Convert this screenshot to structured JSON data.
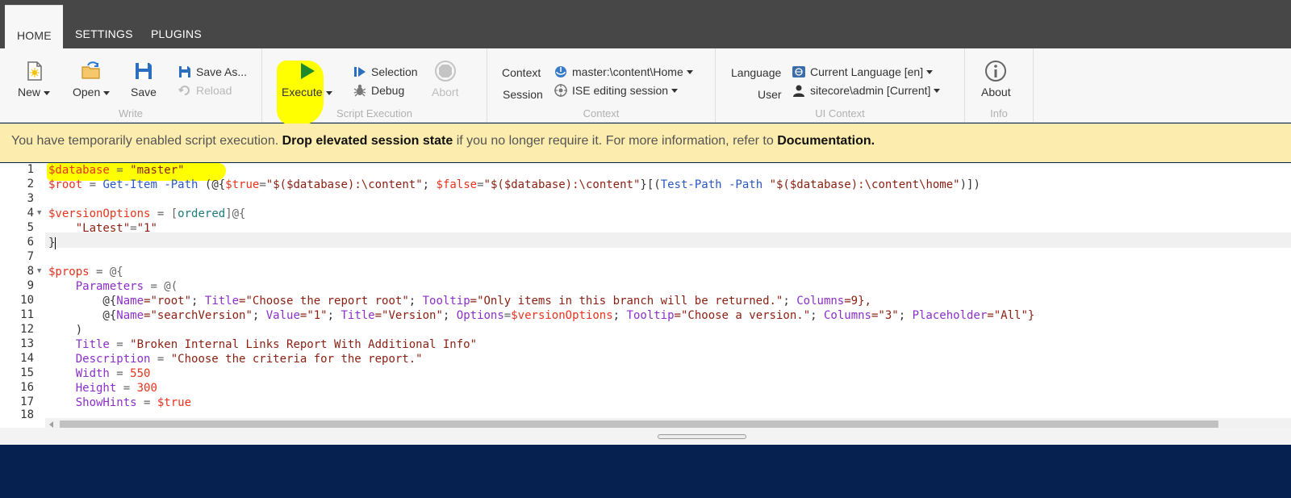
{
  "tabs": [
    {
      "label": "HOME",
      "active": true
    },
    {
      "label": "SETTINGS",
      "active": false
    },
    {
      "label": "PLUGINS",
      "active": false
    }
  ],
  "ribbon": {
    "write": {
      "group_label": "Write",
      "new_label": "New",
      "open_label": "Open",
      "save_label": "Save",
      "save_as_label": "Save As...",
      "reload_label": "Reload"
    },
    "script_execution": {
      "group_label": "Script Execution",
      "execute_label": "Execute",
      "selection_label": "Selection",
      "debug_label": "Debug",
      "abort_label": "Abort"
    },
    "context": {
      "group_label": "Context",
      "context_label": "Context",
      "context_value": "master:\\content\\Home",
      "session_label": "Session",
      "session_value": "ISE editing session"
    },
    "ui_context": {
      "group_label": "UI Context",
      "language_label": "Language",
      "language_value": "Current Language [en]",
      "user_label": "User",
      "user_value": "sitecore\\admin [Current]"
    },
    "info": {
      "group_label": "Info",
      "about_label": "About"
    }
  },
  "warning": {
    "text1": "You have temporarily enabled script execution. ",
    "link1": "Drop elevated session state",
    "text2": " if you no longer require it. For more information, refer to ",
    "link2": "Documentation."
  },
  "editor": {
    "line_numbers": [
      "1",
      "2",
      "3",
      "4",
      "5",
      "6",
      "7",
      "8",
      "9",
      "10",
      "11",
      "12",
      "13",
      "14",
      "15",
      "16",
      "17",
      "18"
    ],
    "code": {
      "l1_var": "$database",
      "l1_op": " = ",
      "l1_str": "\"master\"",
      "l2_var": "$root",
      "l2_op": " = ",
      "l2_cmd": "Get-Item",
      "l2_param": " -Path",
      "l2_open": " (@{",
      "l2_true": "$true",
      "l2_eq1": "=",
      "l2_str1": "\"$($database):\\content\"",
      "l2_semi": "; ",
      "l2_false": "$false",
      "l2_eq2": "=",
      "l2_str2": "\"$($database):\\content\"",
      "l2_mid": "}[(",
      "l2_cmd2": "Test-Path",
      "l2_param2": " -Path",
      "l2_sp": " ",
      "l2_str3": "\"$($database):\\content\\home\"",
      "l2_close": ")])",
      "l4_var": "$versionOptions",
      "l4_op": " = ",
      "l4_br1": "[",
      "l4_type": "ordered",
      "l4_br2": "]@{",
      "l5_key": "    \"Latest\"",
      "l5_eq": "=",
      "l5_val": "\"1\"",
      "l6_close": "}",
      "l8_var": "$props",
      "l8_op": " = @{",
      "l9_key": "    Parameters",
      "l9_op": " = @(",
      "l10_pre": "        @{",
      "l10_k1": "Name",
      "l10_v1": "=\"root\"",
      "l10_s1": "; ",
      "l10_k2": "Title",
      "l10_v2": "=\"Choose the report root\"",
      "l10_s2": "; ",
      "l10_k3": "Tooltip",
      "l10_v3": "=\"Only items in this branch will be returned.\"",
      "l10_s3": "; ",
      "l10_k4": "Columns",
      "l10_v4": "=9},",
      "l11_pre": "        @{",
      "l11_k1": "Name",
      "l11_v1": "=\"searchVersion\"",
      "l11_s1": "; ",
      "l11_k2": "Value",
      "l11_v2": "=\"1\"",
      "l11_s2": "; ",
      "l11_k3": "Title",
      "l11_v3": "=\"Version\"",
      "l11_s3": "; ",
      "l11_k4": "Options",
      "l11_eq4": "=",
      "l11_v4": "$versionOptions",
      "l11_s4": "; ",
      "l11_k5": "Tooltip",
      "l11_v5": "=\"Choose a version.\"",
      "l11_s5": "; ",
      "l11_k6": "Columns",
      "l11_v6": "=\"3\"",
      "l11_s6": "; ",
      "l11_k7": "Placeholder",
      "l11_v7": "=\"All\"}",
      "l12": "    )",
      "l13_key": "    Title",
      "l13_op": " = ",
      "l13_val": "\"Broken Internal Links Report With Additional Info\"",
      "l14_key": "    Description",
      "l14_op": " = ",
      "l14_val": "\"Choose the criteria for the report.\"",
      "l15_key": "    Width",
      "l15_op": " = ",
      "l15_val": "550",
      "l16_key": "    Height",
      "l16_op": " = ",
      "l16_val": "300",
      "l17_key": "    ShowHints",
      "l17_op": " = ",
      "l17_val": "$true"
    }
  },
  "colors": {
    "tabbar": "#474747",
    "ribbon": "#f7f7f7",
    "warning": "#fcecad",
    "highlighter": "#ffff00",
    "footer": "#062150"
  },
  "icons": {
    "new": "new-document-icon",
    "open": "open-folder-icon",
    "save": "floppy-disk-icon",
    "save_as": "save-as-icon",
    "reload": "reload-icon",
    "execute": "play-icon",
    "selection": "run-selection-icon",
    "debug": "bug-icon",
    "abort": "stop-icon",
    "context": "database-icon",
    "session": "session-icon",
    "language": "language-icon",
    "user": "user-icon",
    "about": "info-icon"
  }
}
